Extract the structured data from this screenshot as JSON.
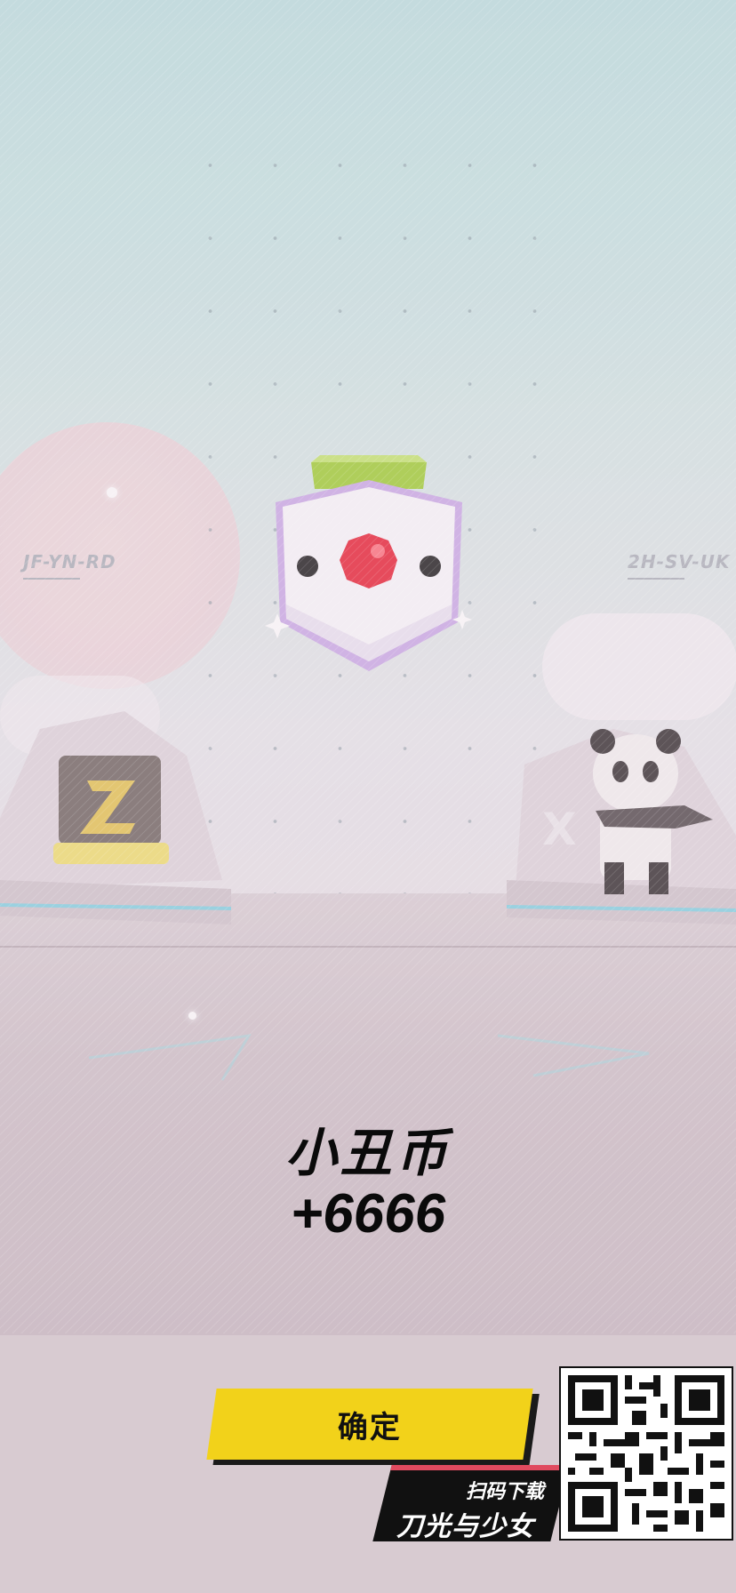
{
  "team_left": {
    "code": "JF-YN-RD"
  },
  "team_right": {
    "code": "2H-SV-UK"
  },
  "reward": {
    "name": "小丑币",
    "amount": "+6666",
    "icon": "clown-coin-icon"
  },
  "confirm_button": {
    "label": "确定"
  },
  "promo": {
    "scan_label": "扫码下载",
    "game_title": "刀光与少女"
  },
  "colors": {
    "accent": "#f2d21a",
    "promo_stripe": "#e04a5f",
    "text": "#0a0a0a"
  }
}
